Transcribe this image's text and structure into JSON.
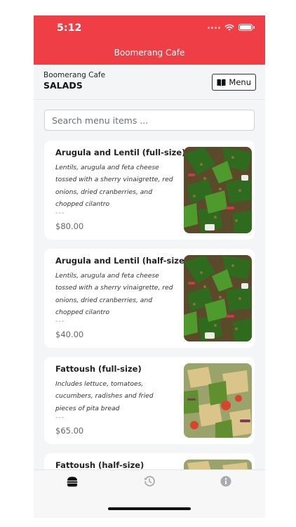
{
  "status_bar": {
    "time": "5:12"
  },
  "app": {
    "title": "Boomerang Cafe"
  },
  "section": {
    "cafe_name": "Boomerang Cafe",
    "category": "SALADS",
    "menu_button_label": "Menu"
  },
  "search": {
    "placeholder": "Search menu items ..."
  },
  "items": [
    {
      "name": "Arugula and Lentil (full-size)",
      "description": "Lentils, arugula and feta cheese tossed with a sherry vinaigrette, red onions, dried cranberries, and chopped cilantro",
      "separator": "---",
      "price": "$80.00",
      "image": "lentil-salad-image"
    },
    {
      "name": "Arugula and Lentil (half-size)",
      "description": "Lentils, arugula and feta cheese tossed with a sherry vinaigrette, red onions, dried cranberries, and chopped cilantro",
      "separator": "---",
      "price": "$40.00",
      "image": "lentil-salad-image"
    },
    {
      "name": "Fattoush (full-size)",
      "description": "Includes lettuce, tomatoes, cucumbers, radishes and fried pieces of pita bread",
      "separator": "---",
      "price": "$65.00",
      "image": "fattoush-salad-image"
    },
    {
      "name": "Fattoush (half-size)",
      "image": "fattoush-salad-image"
    }
  ],
  "tabbar": {
    "tabs": [
      {
        "icon": "burger-icon",
        "active": true
      },
      {
        "icon": "history-icon",
        "active": false
      },
      {
        "icon": "info-icon",
        "active": false
      }
    ]
  },
  "colors": {
    "accent": "#ef3e45",
    "background": "#f4f5f7",
    "card": "#ffffff"
  }
}
